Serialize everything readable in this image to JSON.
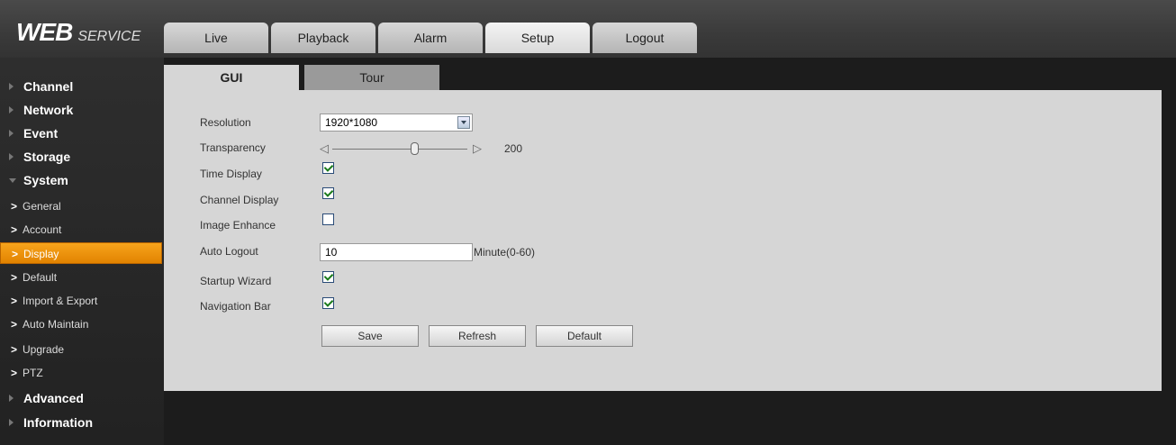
{
  "header": {
    "logo_big": "WEB",
    "logo_small": "SERVICE",
    "tabs": [
      {
        "label": "Live"
      },
      {
        "label": "Playback"
      },
      {
        "label": "Alarm"
      },
      {
        "label": "Setup",
        "active": true
      },
      {
        "label": "Logout"
      }
    ]
  },
  "sidebar": {
    "channel": "Channel",
    "network": "Network",
    "event": "Event",
    "storage": "Storage",
    "system": "System",
    "system_items": {
      "general": "General",
      "account": "Account",
      "display": "Display",
      "default": "Default",
      "import_export": "Import & Export",
      "auto_maintain": "Auto Maintain",
      "upgrade": "Upgrade",
      "ptz": "PTZ"
    },
    "advanced": "Advanced",
    "information": "Information",
    "active_item": "Display"
  },
  "subtabs": {
    "gui": "GUI",
    "tour": "Tour",
    "active": "GUI"
  },
  "form": {
    "resolution_label": "Resolution",
    "resolution_value": "1920*1080",
    "transparency_label": "Transparency",
    "transparency_value": "200",
    "time_display_label": "Time Display",
    "time_display_checked": true,
    "channel_display_label": "Channel Display",
    "channel_display_checked": true,
    "image_enhance_label": "Image Enhance",
    "image_enhance_checked": false,
    "auto_logout_label": "Auto Logout",
    "auto_logout_value": "10",
    "auto_logout_unit": "Minute(0-60)",
    "startup_wizard_label": "Startup Wizard",
    "startup_wizard_checked": true,
    "navigation_bar_label": "Navigation Bar",
    "navigation_bar_checked": true
  },
  "buttons": {
    "save": "Save",
    "refresh": "Refresh",
    "default": "Default"
  },
  "colors": {
    "active_orange": "#f29400",
    "panel_gray": "#d6d6d6",
    "background_dark": "#1c1c1c"
  }
}
